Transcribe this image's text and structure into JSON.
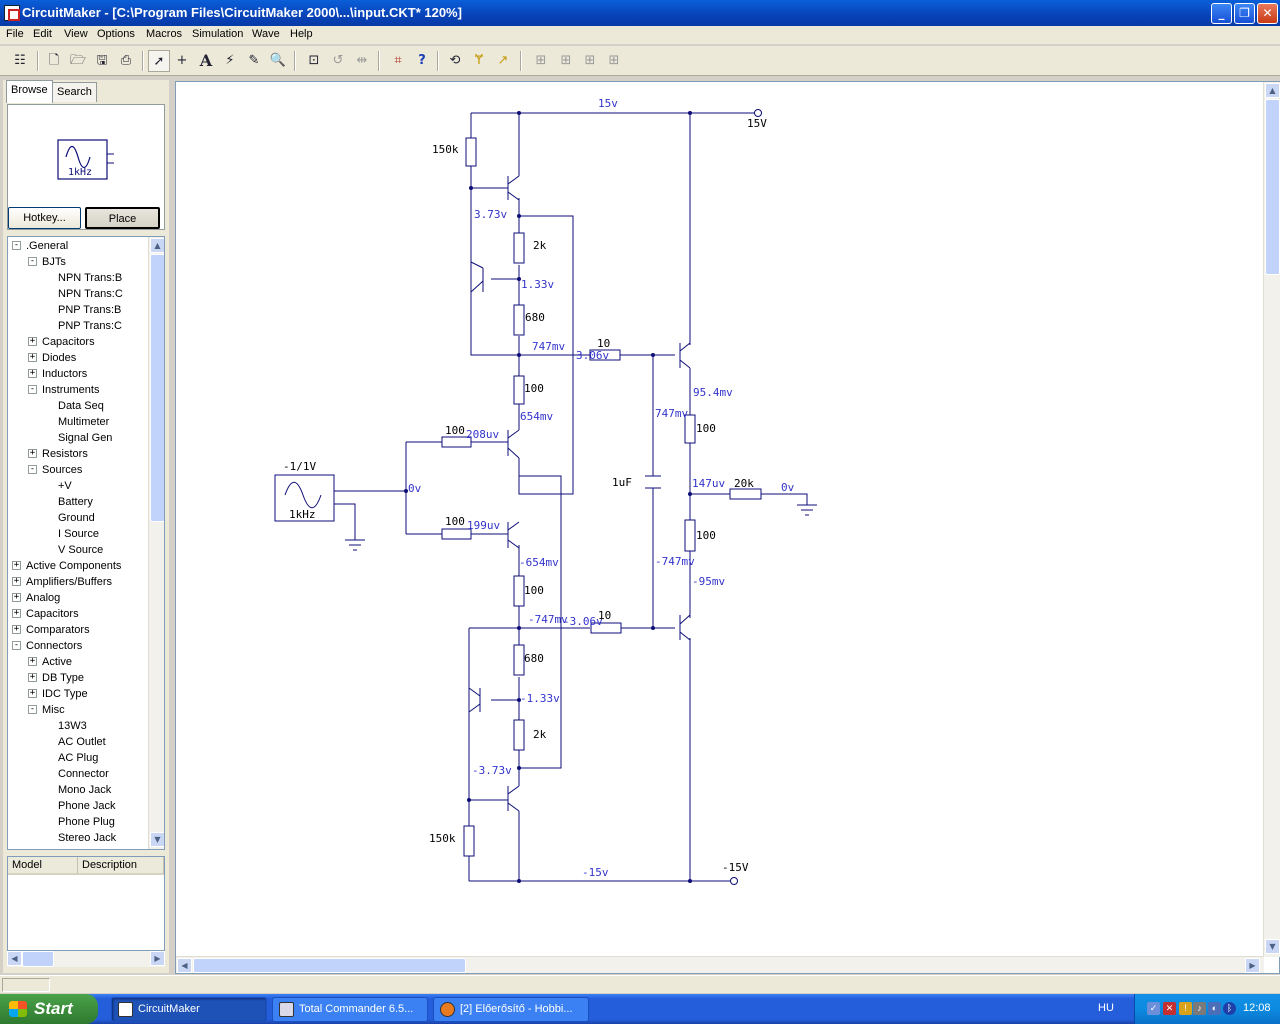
{
  "window": {
    "title": "CircuitMaker - [C:\\Program Files\\CircuitMaker 2000\\...\\input.CKT* 120%]"
  },
  "menu": [
    "File",
    "Edit",
    "View",
    "Options",
    "Macros",
    "Simulation",
    "Wave",
    "Help"
  ],
  "toolbar": {
    "icons": [
      "toolbox-icon",
      "new-file-icon",
      "open-file-icon",
      "save-icon",
      "print-icon",
      "arrow-tool-icon",
      "wire-tool-icon",
      "text-tool-icon",
      "probe-tool-icon",
      "delete-tool-icon",
      "zoom-tool-icon",
      "zoom-fit-icon",
      "rotate-icon",
      "mirror-icon",
      "trace-icon",
      "help-icon",
      "undo-icon",
      "wand-icon",
      "netlist-icon",
      "align-left-icon",
      "align-center-icon",
      "align-right-icon",
      "distribute-icon"
    ]
  },
  "panel": {
    "tabs": {
      "browse": "Browse",
      "search": "Search"
    },
    "preview_label": "1kHz",
    "hotkey_button": "Hotkey...",
    "place_button": "Place",
    "tree": [
      {
        "label": ".General",
        "level": 0,
        "toggle": "-"
      },
      {
        "label": "BJTs",
        "level": 1,
        "toggle": "-"
      },
      {
        "label": "NPN Trans:B",
        "level": 2,
        "toggle": ""
      },
      {
        "label": "NPN Trans:C",
        "level": 2,
        "toggle": ""
      },
      {
        "label": "PNP Trans:B",
        "level": 2,
        "toggle": ""
      },
      {
        "label": "PNP Trans:C",
        "level": 2,
        "toggle": ""
      },
      {
        "label": "Capacitors",
        "level": 1,
        "toggle": "+"
      },
      {
        "label": "Diodes",
        "level": 1,
        "toggle": "+"
      },
      {
        "label": "Inductors",
        "level": 1,
        "toggle": "+"
      },
      {
        "label": "Instruments",
        "level": 1,
        "toggle": "-"
      },
      {
        "label": "Data Seq",
        "level": 2,
        "toggle": ""
      },
      {
        "label": "Multimeter",
        "level": 2,
        "toggle": ""
      },
      {
        "label": "Signal Gen",
        "level": 2,
        "toggle": ""
      },
      {
        "label": "Resistors",
        "level": 1,
        "toggle": "+"
      },
      {
        "label": "Sources",
        "level": 1,
        "toggle": "-"
      },
      {
        "label": "+V",
        "level": 2,
        "toggle": ""
      },
      {
        "label": "Battery",
        "level": 2,
        "toggle": ""
      },
      {
        "label": "Ground",
        "level": 2,
        "toggle": ""
      },
      {
        "label": "I Source",
        "level": 2,
        "toggle": ""
      },
      {
        "label": "V Source",
        "level": 2,
        "toggle": ""
      },
      {
        "label": "Active Components",
        "level": 0,
        "toggle": "+"
      },
      {
        "label": "Amplifiers/Buffers",
        "level": 0,
        "toggle": "+"
      },
      {
        "label": "Analog",
        "level": 0,
        "toggle": "+"
      },
      {
        "label": "Capacitors",
        "level": 0,
        "toggle": "+"
      },
      {
        "label": "Comparators",
        "level": 0,
        "toggle": "+"
      },
      {
        "label": "Connectors",
        "level": 0,
        "toggle": "-"
      },
      {
        "label": "Active",
        "level": 1,
        "toggle": "+"
      },
      {
        "label": "DB Type",
        "level": 1,
        "toggle": "+"
      },
      {
        "label": "IDC Type",
        "level": 1,
        "toggle": "+"
      },
      {
        "label": "Misc",
        "level": 1,
        "toggle": "-"
      },
      {
        "label": "13W3",
        "level": 2,
        "toggle": ""
      },
      {
        "label": "AC Outlet",
        "level": 2,
        "toggle": ""
      },
      {
        "label": "AC Plug",
        "level": 2,
        "toggle": ""
      },
      {
        "label": "Connector",
        "level": 2,
        "toggle": ""
      },
      {
        "label": "Mono Jack",
        "level": 2,
        "toggle": ""
      },
      {
        "label": "Phone Jack",
        "level": 2,
        "toggle": ""
      },
      {
        "label": "Phone Plug",
        "level": 2,
        "toggle": ""
      },
      {
        "label": "Stereo Jack",
        "level": 2,
        "toggle": ""
      }
    ],
    "columns": {
      "model": "Model",
      "description": "Description"
    }
  },
  "schematic": {
    "labels": {
      "rail_pos": "15v",
      "rail_pos_port": "15V",
      "rail_neg": "-15v",
      "rail_neg_port": "-15V",
      "r150k_top": "150k",
      "r2k_top": "2k",
      "r680_top": "680",
      "r100_top": "100",
      "v_373": "3.73v",
      "v_133": "1.33v",
      "v_747": "747mv",
      "v_654": "654mv",
      "v_208": "208uv",
      "v_0": "0v",
      "v_199": "199uv",
      "v_m654": "-654mv",
      "r100_bot": "100",
      "v_m747": "-747mv",
      "r680_bot": "680",
      "v_m133": "-1.33v",
      "r2k_bot": "2k",
      "v_m373": "-3.73v",
      "r150k_bot": "150k",
      "r100_in1": "100",
      "r100_in2": "100",
      "gen_amp": "-1/1V",
      "gen_freq": "1kHz",
      "r10_top": "10",
      "v_306": "3.06v",
      "r10_bot": "10",
      "v_m306": "-3.06v",
      "v_747b": "747mv",
      "c1": "1uF",
      "v_m747b": "-747mv",
      "v_954": "95.4mv",
      "r100_out1": "100",
      "v_147": "147uv",
      "r100_out2": "100",
      "v_m95": "-95mv",
      "r20k": "20k",
      "v_out0": "0v"
    }
  },
  "taskbar": {
    "start": "Start",
    "tasks": [
      "CircuitMaker",
      "Total Commander 6.5...",
      "[2] Előerősítő - Hobbi..."
    ],
    "language": "HU",
    "clock": "12:08"
  },
  "colors": {
    "wire": "#0d0d78",
    "voltage": "#3333cc",
    "title_bar": "#0a5fd8",
    "taskbar": "#245edb"
  }
}
